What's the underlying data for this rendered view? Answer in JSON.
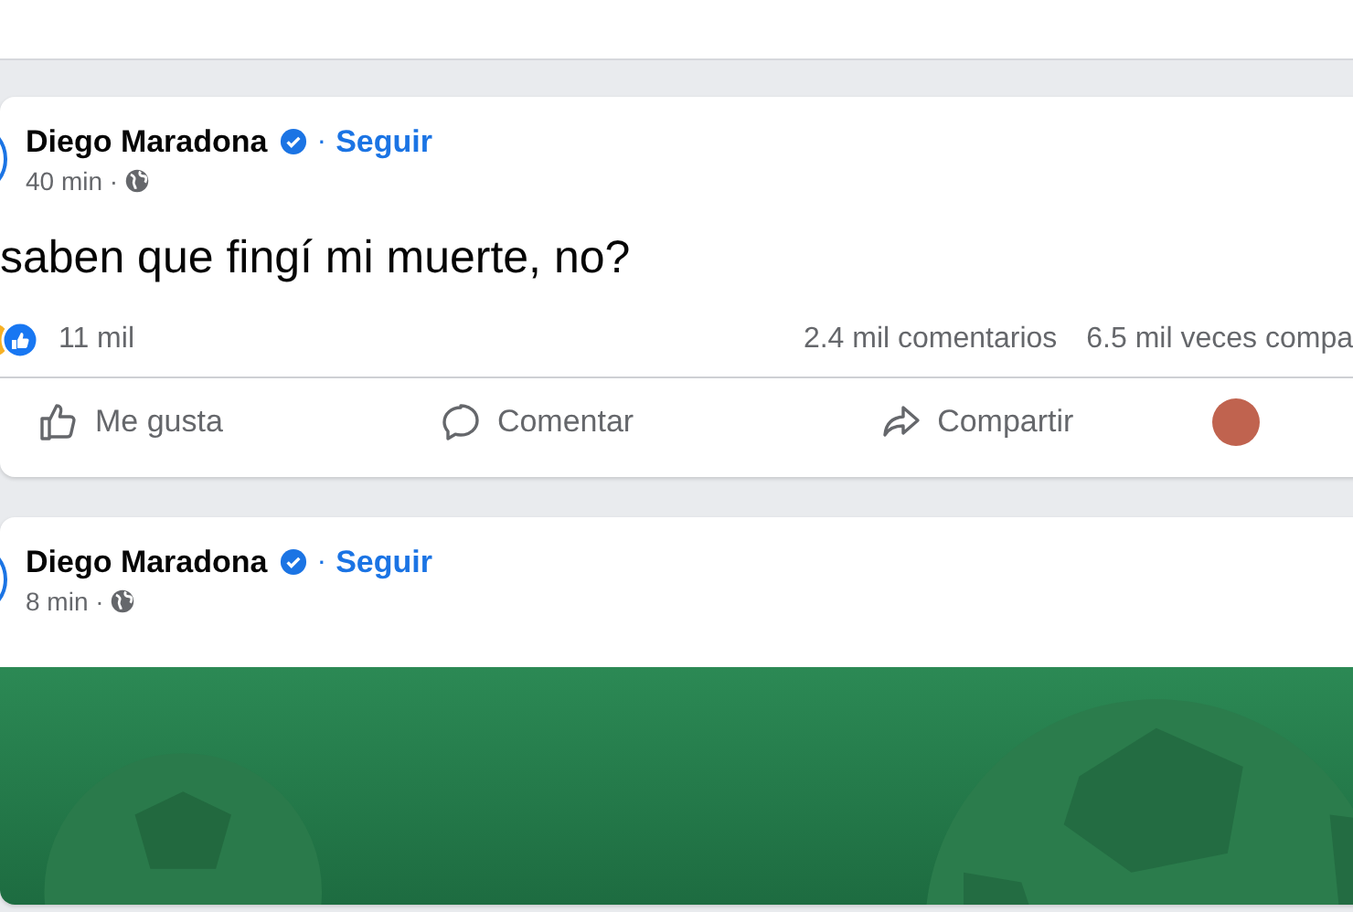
{
  "posts": [
    {
      "author": "Diego Maradona",
      "verified": true,
      "separator": "·",
      "follow": "Seguir",
      "time": "40 min ·",
      "text": "saben que fingí mi muerte, no?",
      "reactions": "11 mil",
      "comments": "2.4 mil comentarios",
      "shares": "6.5 mil veces compa",
      "actions": [
        {
          "kind": "like",
          "label": "Me gusta"
        },
        {
          "kind": "comment",
          "label": "Comentar"
        },
        {
          "kind": "share",
          "label": "Compartir"
        }
      ]
    },
    {
      "author": "Diego Maradona",
      "verified": true,
      "separator": "·",
      "follow": "Seguir",
      "time": "8 min ·"
    }
  ]
}
